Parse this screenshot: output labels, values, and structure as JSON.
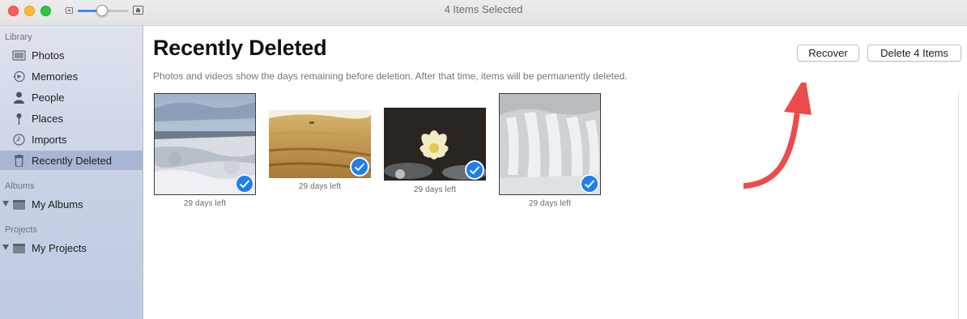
{
  "window": {
    "title": "4 Items Selected"
  },
  "zoom": {
    "level": 0.48
  },
  "sidebar": {
    "sections": [
      {
        "header": "Library",
        "items": [
          {
            "label": "Photos",
            "icon": "photos-icon",
            "selected": false
          },
          {
            "label": "Memories",
            "icon": "memories-icon",
            "selected": false
          },
          {
            "label": "People",
            "icon": "people-icon",
            "selected": false
          },
          {
            "label": "Places",
            "icon": "places-icon",
            "selected": false
          },
          {
            "label": "Imports",
            "icon": "imports-clock-icon",
            "selected": false
          },
          {
            "label": "Recently Deleted",
            "icon": "trash-icon",
            "selected": true
          }
        ]
      },
      {
        "header": "Albums",
        "items": [
          {
            "label": "My Albums",
            "icon": "folder-icon",
            "disclosure": true
          }
        ]
      },
      {
        "header": "Projects",
        "items": [
          {
            "label": "My Projects",
            "icon": "folder-icon",
            "disclosure": true
          }
        ]
      }
    ]
  },
  "main": {
    "title": "Recently Deleted",
    "subtitle": "Photos and videos show the days remaining before deletion. After that time, items will be permanently deleted.",
    "recover_label": "Recover",
    "delete_label": "Delete 4 Items",
    "photos": [
      {
        "subject": "hot springs landscape",
        "days_left": "29 days left",
        "selected": true
      },
      {
        "subject": "wheat field",
        "days_left": "29 days left",
        "selected": true
      },
      {
        "subject": "water lily",
        "days_left": "29 days left",
        "selected": true
      },
      {
        "subject": "frozen waterfall",
        "days_left": "29 days left",
        "selected": true
      }
    ]
  },
  "colors": {
    "accent": "#1f7ff2",
    "annotation_arrow": "#ec4b4b",
    "sidebar_selection": "#a9b6d3"
  }
}
